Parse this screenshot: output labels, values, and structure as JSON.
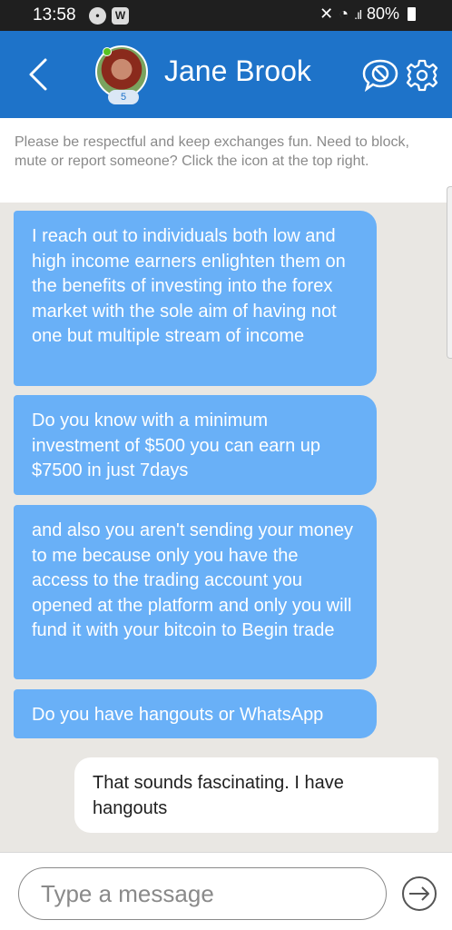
{
  "status_bar": {
    "time": "13:58",
    "battery": "80%"
  },
  "header": {
    "contact_name": "Jane Brook",
    "avatar_badge": "5"
  },
  "notice": "Please be respectful and keep exchanges fun. Need to block, mute or report someone? Click the icon at the top right.",
  "messages": [
    {
      "direction": "incoming",
      "text": "I reach out to individuals both low and high income earners enlighten them on the benefits of investing into the forex market with the sole aim of having not one but multiple stream of income"
    },
    {
      "direction": "incoming",
      "text": "Do you know with a minimum investment of $500 you can earn up $7500 in just 7days"
    },
    {
      "direction": "incoming",
      "text": "and also you aren't sending your money to me because only you have the access to the  trading account you opened at the platform and only you will fund it with your bitcoin to Begin trade"
    },
    {
      "direction": "incoming",
      "text": "Do you have hangouts or WhatsApp"
    },
    {
      "direction": "outgoing",
      "text": "That sounds fascinating.  I have hangouts"
    }
  ],
  "composer": {
    "placeholder": "Type a message"
  },
  "colors": {
    "header": "#1e73c9",
    "incoming_bubble": "#69b0f7",
    "outgoing_bubble": "#ffffff",
    "chat_background": "#e9e7e3"
  }
}
